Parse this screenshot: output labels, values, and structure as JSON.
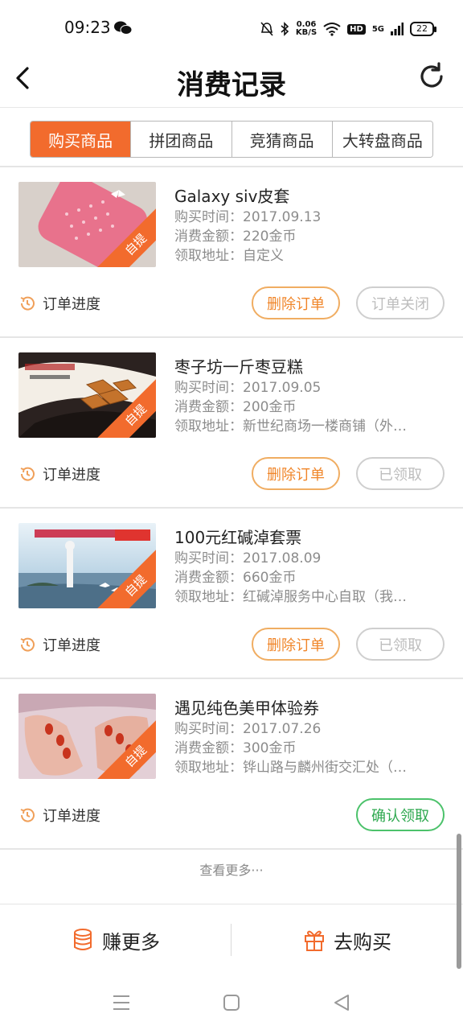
{
  "status_bar": {
    "time": "09:23",
    "net_speed_value": "0.06",
    "net_speed_unit": "KB/S",
    "hd_badge": "HD",
    "signal_label": "5G",
    "battery": "22"
  },
  "header": {
    "title": "消费记录"
  },
  "tabs": [
    {
      "label": "购买商品",
      "active": true
    },
    {
      "label": "拼团商品",
      "active": false
    },
    {
      "label": "竞猜商品",
      "active": false
    },
    {
      "label": "大转盘商品",
      "active": false
    }
  ],
  "orders": [
    {
      "name": "Galaxy siv皮套",
      "purchase_time": "购买时间：2017.09.13",
      "amount": "消费金额：220金币",
      "address": "领取地址：自定义",
      "badge": "自提",
      "progress_label": "订单进度",
      "delete_label": "删除订单",
      "status_label": "订单关闭"
    },
    {
      "name": "枣子坊一斤枣豆糕",
      "purchase_time": "购买时间：2017.09.05",
      "amount": "消费金额：200金币",
      "address": "领取地址：新世纪商场一楼商铺（外…",
      "badge": "自提",
      "progress_label": "订单进度",
      "delete_label": "删除订单",
      "status_label": "已领取"
    },
    {
      "name": "100元红碱淖套票",
      "purchase_time": "购买时间：2017.08.09",
      "amount": "消费金额：660金币",
      "address": "领取地址：红碱淖服务中心自取（我…",
      "badge": "自提",
      "progress_label": "订单进度",
      "delete_label": "删除订单",
      "status_label": "已领取"
    },
    {
      "name": "遇见纯色美甲体验券",
      "purchase_time": "购买时间：2017.07.26",
      "amount": "消费金额：300金币",
      "address": "领取地址：铧山路与麟州街交汇处（…",
      "badge": "自提",
      "progress_label": "订单进度",
      "confirm_label": "确认领取"
    }
  ],
  "load_more": "查看更多···",
  "bottom_bar": {
    "earn_label": "赚更多",
    "buy_label": "去购买"
  },
  "colors": {
    "accent": "#f26b2d",
    "button_orange": "#f0862a",
    "button_green": "#2ea84f",
    "button_gray": "#bdbdbd"
  }
}
